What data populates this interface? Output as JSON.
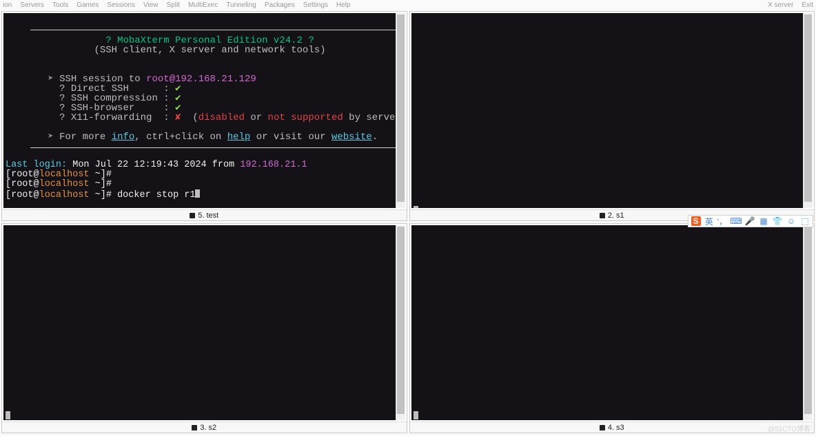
{
  "menu": {
    "left": [
      "ion",
      "Servers",
      "Tools",
      "Games",
      "Sessions",
      "View",
      "Split",
      "MultiExec",
      "Tunneling",
      "Packages",
      "Settings",
      "Help"
    ],
    "right": [
      "X server",
      "Exit"
    ]
  },
  "panes": [
    {
      "tab_icon": "terminal-icon",
      "tab_label": "5. test",
      "scroll_top": true
    },
    {
      "tab_icon": "terminal-icon",
      "tab_label": "2. s1",
      "scroll_top": true
    },
    {
      "tab_icon": "terminal-icon",
      "tab_label": "3. s2",
      "scroll_top": false
    },
    {
      "tab_icon": "terminal-icon",
      "tab_label": "4. s3",
      "scroll_top": false
    }
  ],
  "banner": {
    "title_q1": "? ",
    "title": "MobaXterm Personal Edition v24.2",
    "title_q2": " ?",
    "subtitle": "(SSH client, X server and network tools)",
    "session_prefix": "SSH session to ",
    "session_target": "root@192.168.21.129",
    "rows": [
      {
        "label": "Direct SSH",
        "ok": true,
        "note": ""
      },
      {
        "label": "SSH compression",
        "ok": true,
        "note": ""
      },
      {
        "label": "SSH-browser",
        "ok": true,
        "note": ""
      },
      {
        "label": "X11-forwarding",
        "ok": false,
        "note_open": "(",
        "note_dis": "disabled",
        " note_or": " or ",
        "note_ns": "not supported",
        "note_close": " by server)"
      }
    ],
    "more_prefix": "For more ",
    "info": "info",
    "more_mid": ", ctrl+click on ",
    "help": "help",
    "more_mid2": " or visit our ",
    "website": "website",
    "more_tail": "."
  },
  "session": {
    "last_login_label": "Last login:",
    "last_login_rest": " Mon Jul 22 12:19:43 2024 from ",
    "last_login_ip": "192.168.21.1",
    "prompt_open": "[",
    "prompt_user": "root",
    "prompt_at": "@",
    "prompt_host": "localhost",
    "prompt_tail": " ~]# ",
    "command": "docker stop r1"
  },
  "ime": {
    "logo": "S",
    "lang": "英",
    "punct": "'，",
    "icons": [
      "keyboard-icon",
      "mic-icon",
      "grid-icon",
      "shirt-icon",
      "face-icon",
      "apps-icon"
    ]
  },
  "watermark": "@51CTO博客"
}
